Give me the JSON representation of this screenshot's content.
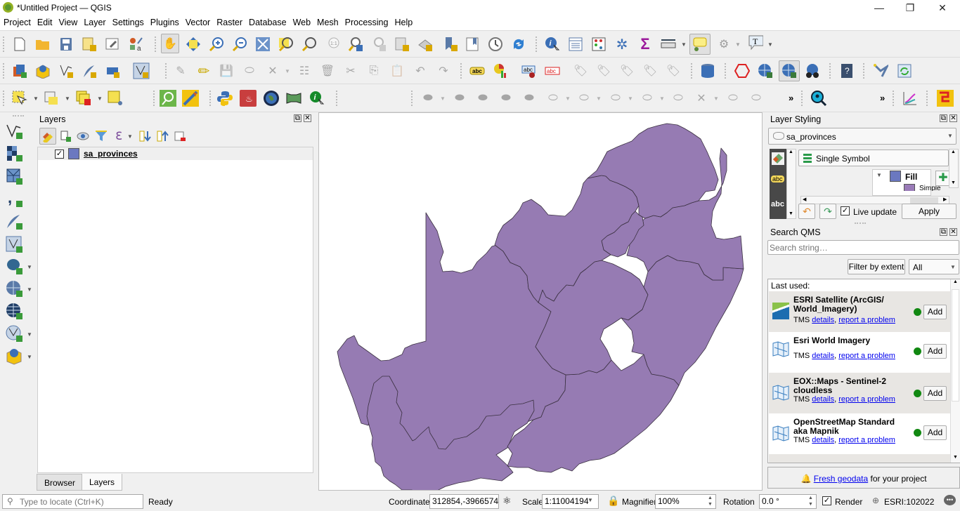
{
  "window": {
    "title": "*Untitled Project — QGIS",
    "minimize_glyph": "—",
    "restore_glyph": "❐",
    "close_glyph": "✕"
  },
  "menu": [
    "Project",
    "Edit",
    "View",
    "Layer",
    "Settings",
    "Plugins",
    "Vector",
    "Raster",
    "Database",
    "Web",
    "Mesh",
    "Processing",
    "Help"
  ],
  "toolbars": {
    "row1": [
      "new-project",
      "open-project",
      "save-project",
      "new-print-layout",
      "layout-manager",
      "style-manager",
      "pan-map",
      "pan-to-selection",
      "zoom-in",
      "zoom-out",
      "zoom-full",
      "zoom-to-selection",
      "zoom-to-layer",
      "zoom-native",
      "zoom-last",
      "zoom-next",
      "new-map-view",
      "new-3d-map-view",
      "new-bookmark",
      "show-bookmarks",
      "temporal-controller",
      "refresh",
      "identify-features",
      "open-attribute-table",
      "open-field-calculator",
      "processing-toolbox",
      "statistical-summary",
      "measure-line",
      "map-tips",
      "run-feature-action",
      "text-annotation"
    ],
    "row2_overflow": "»"
  },
  "layers_panel": {
    "title": "Layers",
    "layers": [
      {
        "name": "sa_provinces",
        "visible": true,
        "symbol_color": "#6b78c0"
      }
    ],
    "tabs": [
      {
        "label": "Browser",
        "active": false
      },
      {
        "label": "Layers",
        "active": true
      }
    ]
  },
  "layer_styling": {
    "title": "Layer Styling",
    "layer": "sa_provinces",
    "renderer": "Single Symbol",
    "symbol_tree": {
      "root": "Fill",
      "child": "Simple fill",
      "root_color": "#6b78c0",
      "child_color": "#9a7bb8"
    },
    "live_update": true,
    "live_update_label": "Live update",
    "apply_label": "Apply"
  },
  "search_qms": {
    "title": "Search QMS",
    "placeholder": "Search string…",
    "filter_button": "Filter by extent",
    "filter_value": "All",
    "section_label": "Last used:",
    "results": [
      {
        "name": "ESRI Satellite (ArcGIS/ World_Imagery)",
        "type": "TMS",
        "details": "details",
        "report": "report a problem",
        "status": "#118811",
        "add": "Add"
      },
      {
        "name": "Esri World Imagery",
        "type": "TMS",
        "details": "details",
        "report": "report a problem",
        "status": "#118811",
        "add": "Add"
      },
      {
        "name": "EOX::Maps - Sentinel-2 cloudless",
        "type": "TMS",
        "details": "details",
        "report": "report a problem",
        "status": "#118811",
        "add": "Add"
      },
      {
        "name": "OpenStreetMap Standard aka Mapnik",
        "type": "TMS",
        "details": "details",
        "report": "report a problem",
        "status": "#118811",
        "add": "Add"
      }
    ],
    "footer_link": "Fresh geodata",
    "footer_text": " for your project"
  },
  "map": {
    "fill_color": "#967bb3",
    "stroke_color": "#3a3040",
    "layer": "sa_provinces"
  },
  "statusbar": {
    "locator_placeholder": "Type to locate (Ctrl+K)",
    "message": "Ready",
    "coordinate_label": "Coordinate",
    "coordinate": "312854,-3966574",
    "scale_label": "Scale",
    "scale": "1:11004194",
    "magnifier_label": "Magnifier",
    "magnifier": "100%",
    "rotation_label": "Rotation",
    "rotation": "0.0 °",
    "render_label": "Render",
    "render": true,
    "crs": "ESRI:102022"
  }
}
